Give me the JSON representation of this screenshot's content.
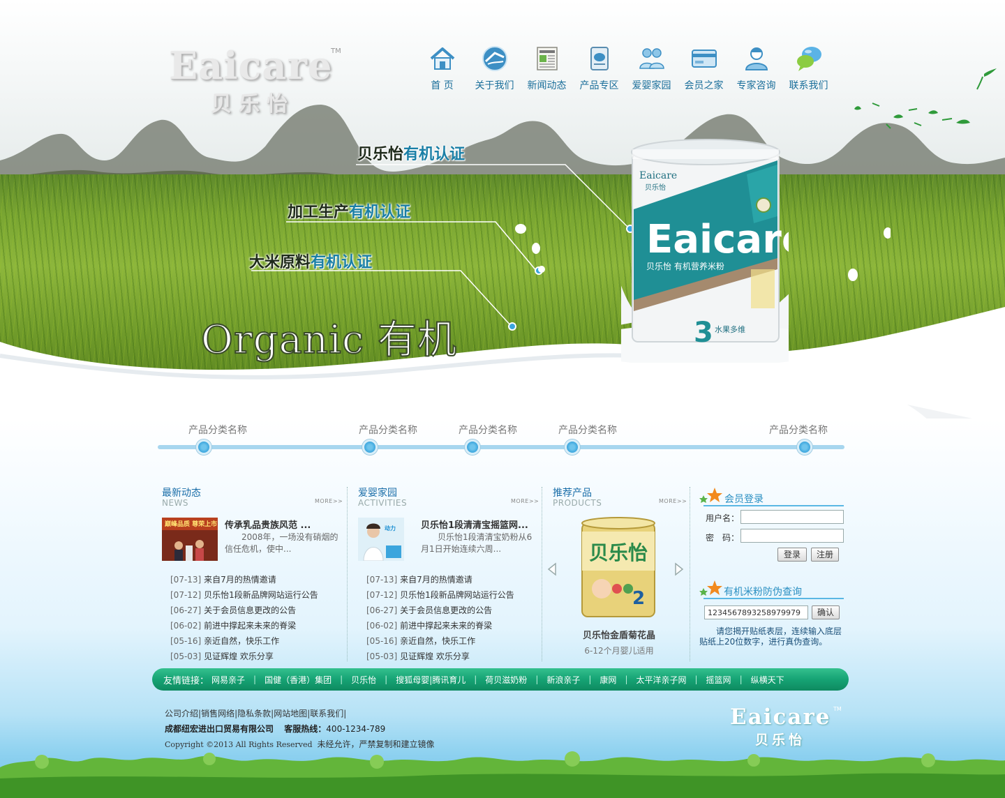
{
  "brand": {
    "logo_en": "Eaicare",
    "logo_tm": "TM",
    "logo_cn": "贝乐怡"
  },
  "nav": [
    {
      "label": "首 页",
      "icon": "home-icon"
    },
    {
      "label": "关于我们",
      "icon": "globe-icon"
    },
    {
      "label": "新闻动态",
      "icon": "newspaper-icon"
    },
    {
      "label": "产品专区",
      "icon": "product-can-icon"
    },
    {
      "label": "爱婴家园",
      "icon": "family-icon"
    },
    {
      "label": "会员之家",
      "icon": "card-icon"
    },
    {
      "label": "专家咨询",
      "icon": "expert-icon"
    },
    {
      "label": "联系我们",
      "icon": "chat-bubble-icon"
    }
  ],
  "banner": {
    "claims": [
      {
        "prefix": "贝乐怡",
        "highlight": "有机认证"
      },
      {
        "prefix": "加工生产",
        "highlight": "有机认证"
      },
      {
        "prefix": "大米原料",
        "highlight": "有机认证"
      }
    ],
    "slogan": "Organic 有机",
    "can": {
      "brand_small": "Eaicare",
      "brand_cn_small": "贝乐怡",
      "brand_big": "Eaicare",
      "product_line": "贝乐怡 有机营养米粉",
      "stage": "3",
      "flavor": "水果多维"
    }
  },
  "categories": [
    "产品分类名称",
    "产品分类名称",
    "产品分类名称",
    "产品分类名称",
    "产品分类名称"
  ],
  "news": {
    "title": "最新动态",
    "subtitle": "NEWS",
    "more": "MORE>>",
    "feature": {
      "title": "传承乳品贵族风范 ...",
      "text": "2008年，一场没有硝烟的信任危机，使中...",
      "image_text": "巅峰品质 尊荣上市"
    },
    "items": [
      {
        "date": "[07-13]",
        "text": "来自7月的热情邀请"
      },
      {
        "date": "[07-12]",
        "text": "贝乐怡1段新品牌网站运行公告"
      },
      {
        "date": "[06-27]",
        "text": "关于会员信息更改的公告"
      },
      {
        "date": "[06-02]",
        "text": "前进中撑起来未来的脊梁"
      },
      {
        "date": "[05-16]",
        "text": "亲近自然，快乐工作"
      },
      {
        "date": "[05-03]",
        "text": "见证辉煌 欢乐分享"
      }
    ]
  },
  "activities": {
    "title": "爱婴家园",
    "subtitle": "ACTIVITIES",
    "more": "MORE>>",
    "feature": {
      "title": "贝乐怡1段清清宝摇篮网...",
      "text": "贝乐怡1段清清宝奶粉从6月1日开始连续六周...",
      "image_text": "动力"
    },
    "items": [
      {
        "date": "[07-13]",
        "text": "来自7月的热情邀请"
      },
      {
        "date": "[07-12]",
        "text": "贝乐怡1段新品牌网站运行公告"
      },
      {
        "date": "[06-27]",
        "text": "关于会员信息更改的公告"
      },
      {
        "date": "[06-02]",
        "text": "前进中撑起来未来的脊梁"
      },
      {
        "date": "[05-16]",
        "text": "亲近自然，快乐工作"
      },
      {
        "date": "[05-03]",
        "text": "见证辉煌 欢乐分享"
      }
    ]
  },
  "products": {
    "title": "推荐产品",
    "subtitle": "PRODUCTS",
    "more": "MORE>>",
    "name": "贝乐怡金盾菊花晶",
    "desc": "6-12个月婴儿适用",
    "can_label": "贝乐怡",
    "can_stage": "2"
  },
  "login": {
    "title": "会员登录",
    "username_label": "用户名：",
    "password_label": "密　码：",
    "username_value": "",
    "password_value": "",
    "login_button": "登录",
    "register_button": "注册"
  },
  "verify": {
    "title": "有机米粉防伪查询",
    "code_value": "1234567893258979979",
    "confirm_button": "确认",
    "tip": "请您揭开贴纸表层，连续输入底层贴纸上20位数字，进行真伪查询。"
  },
  "friend_links": {
    "label": "友情链接：",
    "items": [
      "网易亲子",
      "国健（香港）集团",
      "贝乐怡",
      "搜狐母婴|腾讯育儿",
      "荷贝滋奶粉",
      "新浪亲子",
      "康网",
      "太平洋亲子网",
      "摇篮网",
      "纵横天下"
    ]
  },
  "footer": {
    "links": [
      "公司介绍",
      "销售网络",
      "隐私条款",
      "网站地图",
      "联系我们"
    ],
    "company": "成都纽宏进出口贸易有限公司",
    "hotline_label": "客服热线：",
    "hotline": "400-1234-789",
    "copyright": "Copyright ©2013  All Rights Reserved",
    "notice": "未经允许，严禁复制和建立镜像",
    "logo_en": "Eaicare",
    "logo_tm": "TM",
    "logo_cn": "贝乐怡"
  },
  "colors": {
    "accent_blue": "#1a6ea8",
    "link_green": "#16a374",
    "claim_highlight": "#1a7fa6"
  }
}
